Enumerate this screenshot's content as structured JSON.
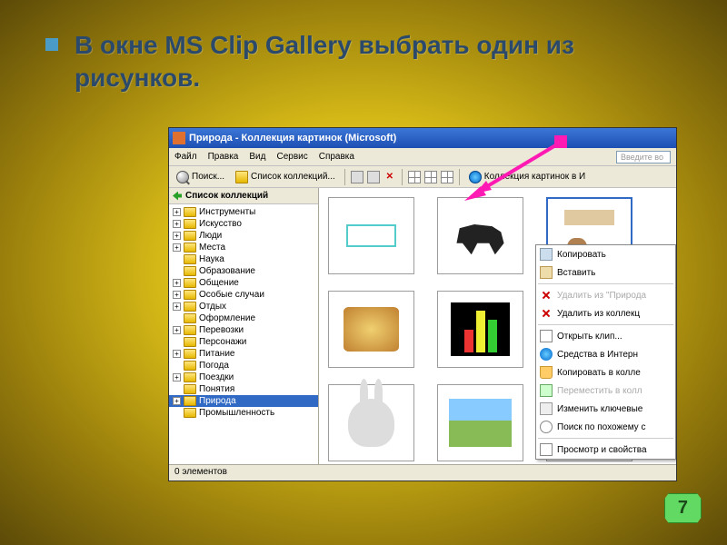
{
  "slide": {
    "heading": "В окне MS Clip Gallery выбрать один из рисунков."
  },
  "window": {
    "title": "Природа - Коллекция картинок (Microsoft)",
    "menus": [
      "Файл",
      "Правка",
      "Вид",
      "Сервис",
      "Справка"
    ],
    "search_placeholder": "Введите во",
    "toolbar": {
      "search": "Поиск...",
      "collections": "Список коллекций...",
      "web": "Коллекция картинок в И"
    },
    "sidebar_title": "Список коллекций",
    "tree": [
      {
        "label": "Инструменты",
        "exp": "+"
      },
      {
        "label": "Искусство",
        "exp": "+"
      },
      {
        "label": "Люди",
        "exp": "+"
      },
      {
        "label": "Места",
        "exp": "+"
      },
      {
        "label": "Наука",
        "exp": ""
      },
      {
        "label": "Образование",
        "exp": ""
      },
      {
        "label": "Общение",
        "exp": "+"
      },
      {
        "label": "Особые случаи",
        "exp": "+"
      },
      {
        "label": "Отдых",
        "exp": "+"
      },
      {
        "label": "Оформление",
        "exp": ""
      },
      {
        "label": "Перевозки",
        "exp": "+"
      },
      {
        "label": "Персонажи",
        "exp": ""
      },
      {
        "label": "Питание",
        "exp": "+"
      },
      {
        "label": "Погода",
        "exp": ""
      },
      {
        "label": "Поездки",
        "exp": "+"
      },
      {
        "label": "Понятия",
        "exp": ""
      },
      {
        "label": "Природа",
        "exp": "+",
        "selected": true
      },
      {
        "label": "Промышленность",
        "exp": ""
      }
    ],
    "context_menu": [
      {
        "label": "Копировать",
        "icon": "ci-copy"
      },
      {
        "label": "Вставить",
        "icon": "ci-paste"
      },
      {
        "sep": true
      },
      {
        "label": "Удалить из \"Природа",
        "icon": "ci-del",
        "disabled": true
      },
      {
        "label": "Удалить из коллекц",
        "icon": "ci-del"
      },
      {
        "sep": true
      },
      {
        "label": "Открыть клип...",
        "icon": "ci-open"
      },
      {
        "label": "Средства в Интерн",
        "icon": "ci-globe"
      },
      {
        "label": "Копировать в колле",
        "icon": "ci-basket"
      },
      {
        "label": "Переместить в колл",
        "icon": "ci-move",
        "disabled": true
      },
      {
        "label": "Изменить ключевые",
        "icon": "ci-key"
      },
      {
        "label": "Поиск по похожему с",
        "icon": "ci-search"
      },
      {
        "sep": true
      },
      {
        "label": "Просмотр и свойства",
        "icon": "ci-prop"
      }
    ],
    "status": "0 элементов"
  },
  "page_number": "7"
}
